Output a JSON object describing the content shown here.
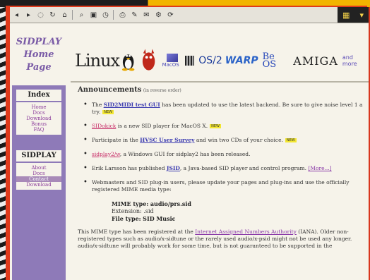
{
  "toolbar": {
    "buttons": [
      "back-icon",
      "forward-icon",
      "stop-icon",
      "reload-icon",
      "home-icon",
      "search-icon",
      "bookmark-icon",
      "history-icon",
      "print-icon",
      "edit-icon",
      "mail-icon",
      "settings-icon",
      "refresh-icon"
    ]
  },
  "logo": {
    "line1": "SIDPLAY",
    "line2": "Home",
    "line3": "Page"
  },
  "banner": {
    "linux": "Linux",
    "macos": "MacOS",
    "os2": "OS/2",
    "warp": "WARP",
    "beos": "Be OS",
    "amiga": "AMIGA",
    "more": "and more"
  },
  "sidebar": {
    "index_title": "Index",
    "index_links": [
      "Home",
      "Docs",
      "Download",
      "Bonus",
      "FAQ"
    ],
    "sidplay_title": "SIDPLAY",
    "sidplay_links": [
      "About",
      "Docs",
      "Contact",
      "Download"
    ]
  },
  "main": {
    "title": "Announcements",
    "title_sub": "(in reverse order)",
    "new_badge": "NEW",
    "item1_pre": "The ",
    "item1_link": "SID2MIDI test GUI",
    "item1_post": " has been updated to use the latest backend. Be sure to give noise level 1 a try.",
    "item2_link": "SIDokick",
    "item2_post": " is a new SID player for MacOS X.",
    "item3_pre": "Participate in the ",
    "item3_link": "HVSC User Survey",
    "item3_post": " and win two CDs of your choice.",
    "item4_link": "sidplay2/w",
    "item4_post": ", a Windows GUI for sidplay2 has been released.",
    "item5_pre": "Erik Larsson has published ",
    "item5_link": "JSID",
    "item5_post": ", a Java-based SID player and control program. ",
    "item5_more": "[More...]",
    "item6": "Webmasters and SID plug-in users, please update your pages and plug-ins and use the officially registered MIME media type:",
    "mime_type_label": "MIME type:",
    "mime_type_value": "audio/prs.sid",
    "ext_label": "Extension:",
    "ext_value": ".sid",
    "file_type_label": "File type:",
    "file_type_value": "SID Music",
    "foot_pre": "This MIME type has been registered at the ",
    "foot_link": "Internet Assigned Numbers Authority",
    "foot_post": " (IANA). Older non-registered types such as audio/x-sidtune or the rarely used audio/x-psid might not be used any longer. audio/x-sidtune will probably work for some time, but is not guaranteed to be supported in the"
  }
}
